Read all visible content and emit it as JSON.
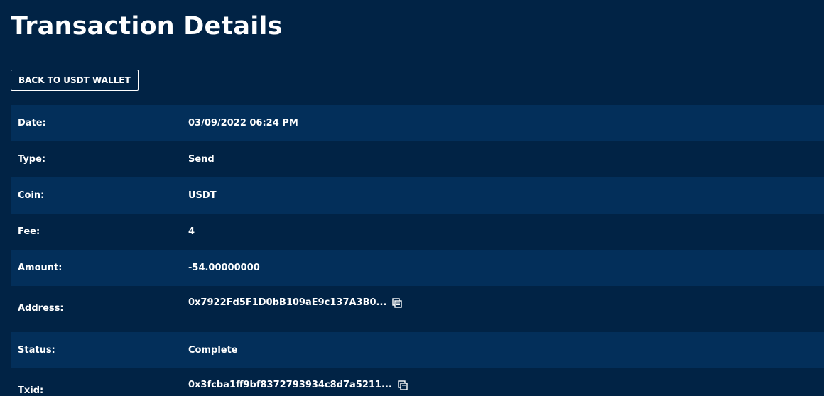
{
  "page": {
    "title": "Transaction Details",
    "back_label": "BACK TO USDT WALLET"
  },
  "details": [
    {
      "label": "Date:",
      "value": "03/09/2022 06:24 PM"
    },
    {
      "label": "Type:",
      "value": "Send"
    },
    {
      "label": "Coin:",
      "value": "USDT"
    },
    {
      "label": "Fee:",
      "value": "4"
    },
    {
      "label": "Amount:",
      "value": "-54.00000000"
    },
    {
      "label": "Address:",
      "value": "0x7922Fd5F1D0bB109aE9c137A3B0...",
      "icon": "copy-icon"
    },
    {
      "label": "Status:",
      "value": "Complete"
    },
    {
      "label": "Txid:",
      "value": "0x3fcba1ff9bf8372793934c8d7a5211...",
      "icon": "copy-icon"
    }
  ],
  "colors": {
    "background": "#012345",
    "row_alt": "#032f5a",
    "text": "#ffffff"
  }
}
